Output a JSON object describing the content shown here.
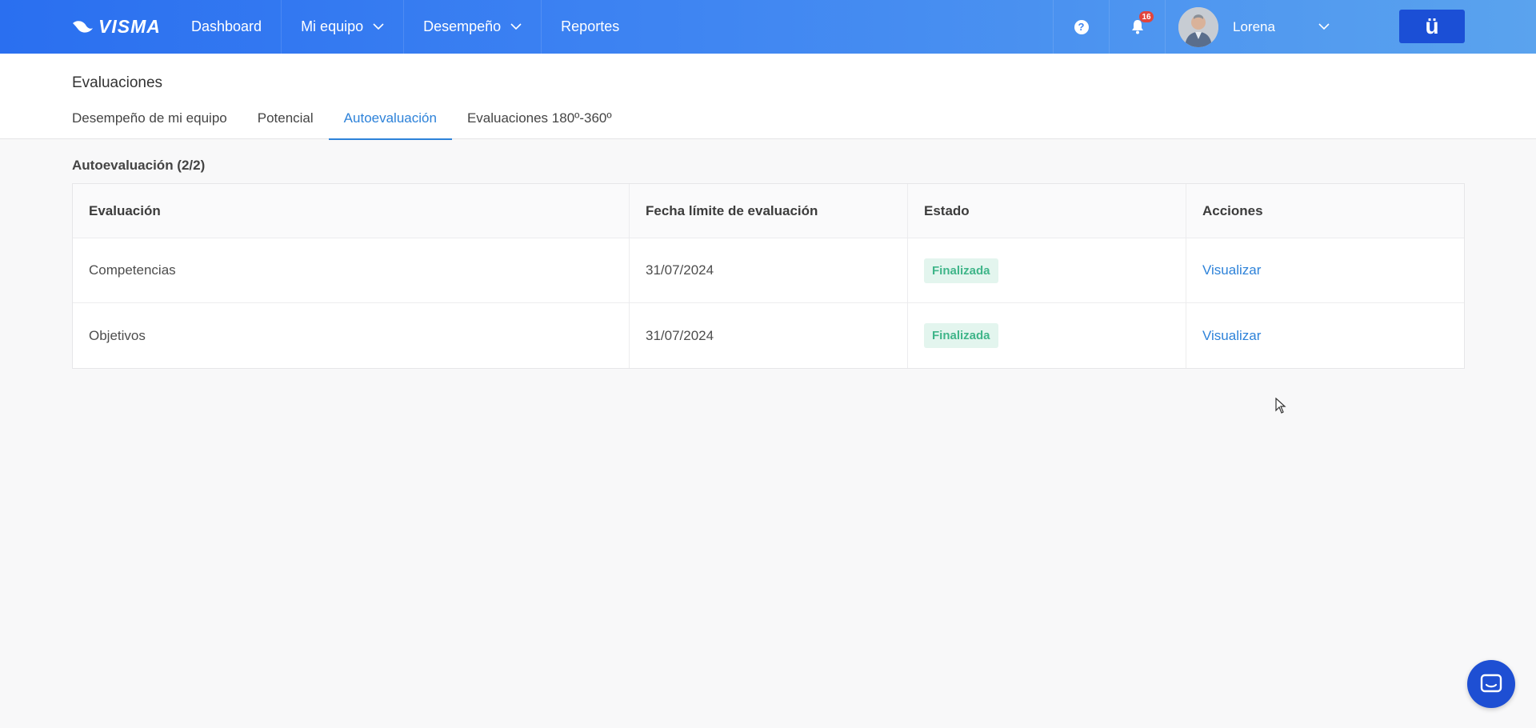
{
  "colors": {
    "accent": "#2d82d9",
    "topbar": "#2a6ff0",
    "status_ok": "#3fb589",
    "brand_button": "#1b4fd6"
  },
  "header": {
    "logo_text": "VISMA",
    "nav": [
      {
        "label": "Dashboard"
      },
      {
        "label": "Mi equipo"
      },
      {
        "label": "Desempeño"
      },
      {
        "label": "Reportes"
      }
    ],
    "help_icon": "?",
    "notifications_count": "16",
    "user_name": "Lorena",
    "brand_button_glyph": "ü"
  },
  "page": {
    "title": "Evaluaciones",
    "tabs": [
      {
        "label": "Desempeño de mi equipo"
      },
      {
        "label": "Potencial"
      },
      {
        "label": "Autoevaluación"
      },
      {
        "label": "Evaluaciones 180º-360º"
      }
    ],
    "section_title": "Autoevaluación (2/2)"
  },
  "table": {
    "columns": [
      "Evaluación",
      "Fecha límite de evaluación",
      "Estado",
      "Acciones"
    ],
    "rows": [
      {
        "evaluation": "Competencias",
        "deadline": "31/07/2024",
        "status": "Finalizada",
        "action": "Visualizar"
      },
      {
        "evaluation": "Objetivos",
        "deadline": "31/07/2024",
        "status": "Finalizada",
        "action": "Visualizar"
      }
    ]
  }
}
